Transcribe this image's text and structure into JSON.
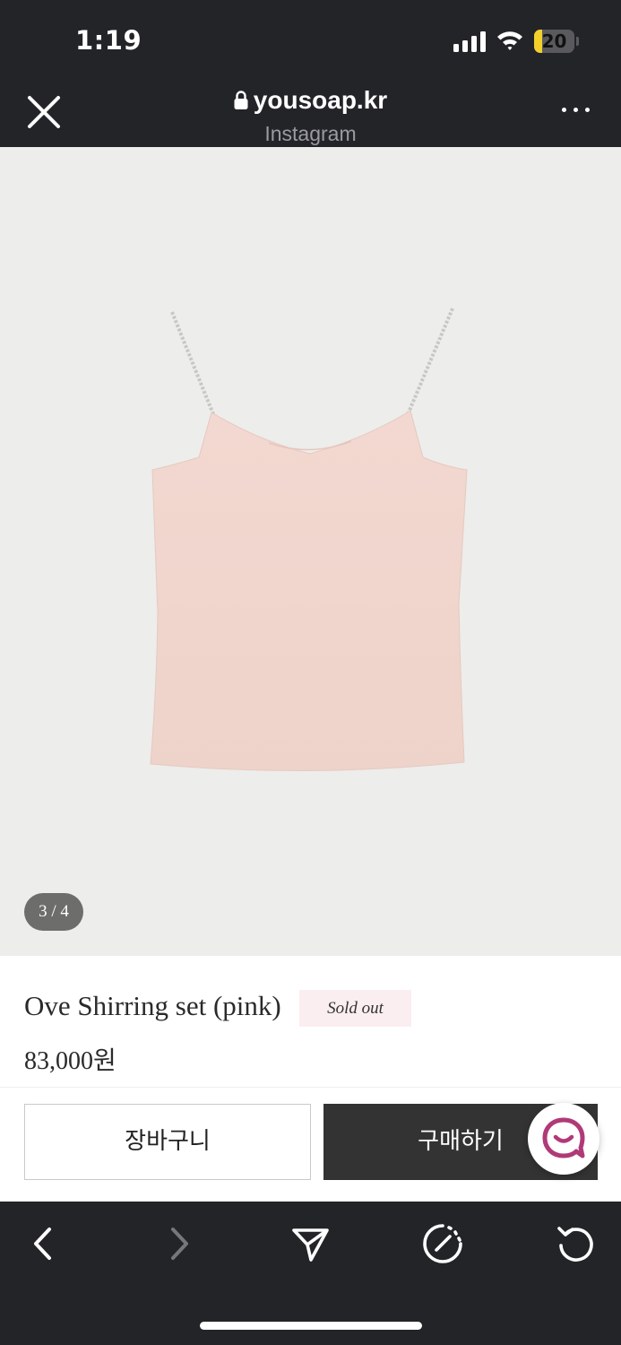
{
  "status_bar": {
    "time": "1:19",
    "battery_level": "20",
    "battery_fraction": 0.2,
    "battery_color": "#f4d12a"
  },
  "browser": {
    "domain": "yousoap.kr",
    "source": "Instagram",
    "close_icon": "close-icon",
    "lock_icon": "lock-icon",
    "more_icon": "more-options-icon"
  },
  "product": {
    "image_counter": "3 / 4",
    "name": "Ove Shirring set (pink)",
    "status_badge": "Sold out",
    "price": "83,000원",
    "image_colors": {
      "background": "#ededeb",
      "garment": "#f0d5cd"
    }
  },
  "actions": {
    "cart_label": "장바구니",
    "buy_label": "구매하기",
    "chat_icon": "chat-icon",
    "chat_color": "#b03a78"
  },
  "toolbar": {
    "items": [
      "back-icon",
      "forward-icon",
      "share-icon",
      "compass-icon",
      "reload-icon"
    ]
  }
}
